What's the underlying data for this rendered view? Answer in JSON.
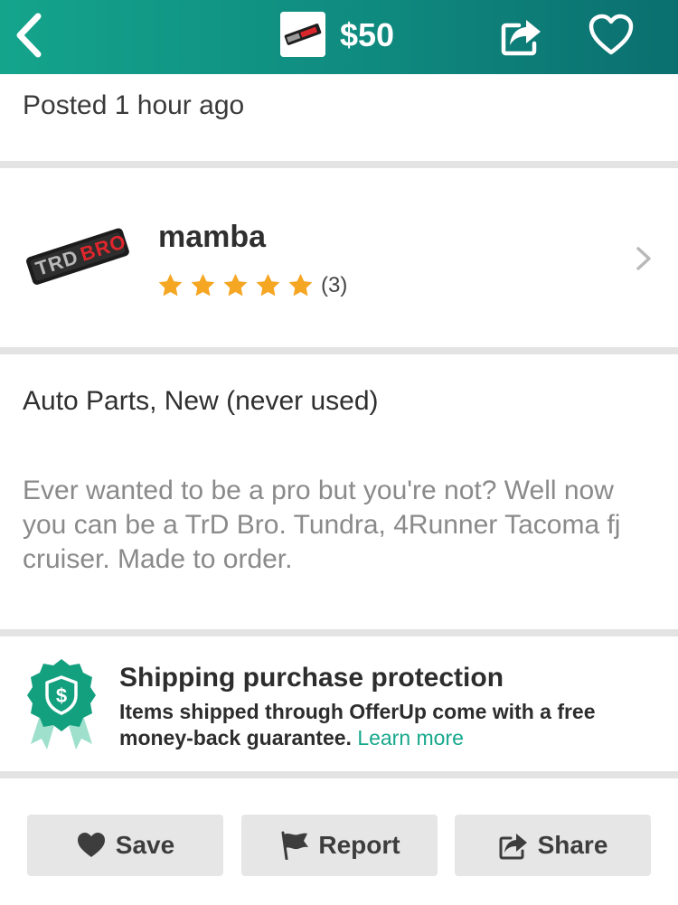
{
  "header": {
    "price": "$50",
    "icons": [
      "chevron-left-icon",
      "listing-thumbnail",
      "share-icon",
      "heart-icon"
    ]
  },
  "posted": "Posted 1 hour ago",
  "seller": {
    "name": "mamba",
    "rating_stars": 5,
    "rating_count": "(3)",
    "thumbnail_text": "TRDBRO"
  },
  "listing": {
    "category": "Auto Parts, New (never used)",
    "description": "Ever wanted to be a pro but you're not? Well now you can be a TrD Bro. Tundra, 4Runner Tacoma fj cruiser. Made to order."
  },
  "protection": {
    "title": "Shipping purchase protection",
    "text": "Items shipped through OfferUp come with a free money-back guarantee.",
    "link": "Learn more"
  },
  "actions": {
    "save": "Save",
    "report": "Report",
    "share": "Share"
  },
  "colors": {
    "brand": "#0f8a7f",
    "accent_link": "#17a88c",
    "star": "#f5a623",
    "button_bg": "#e6e6e6"
  }
}
